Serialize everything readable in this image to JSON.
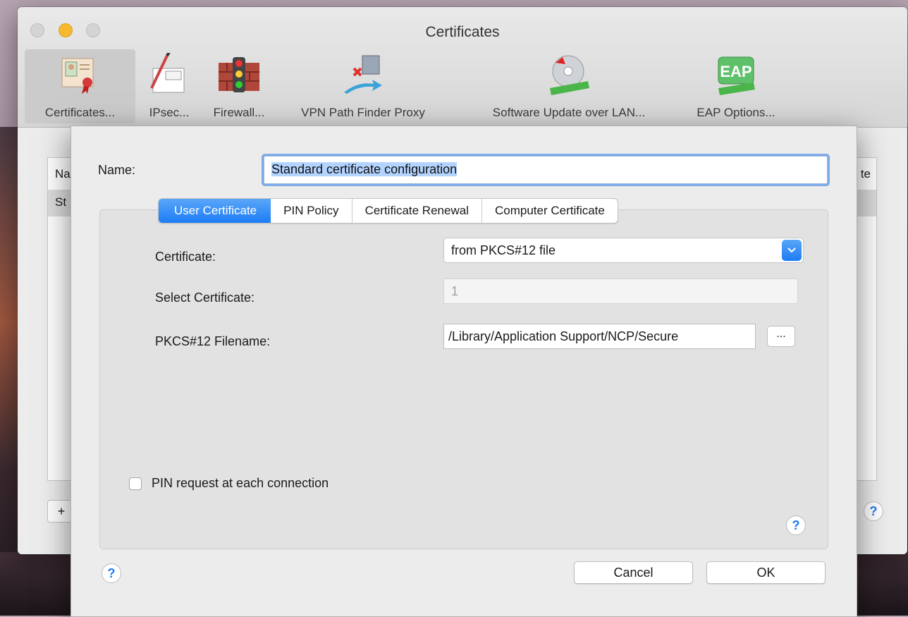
{
  "window": {
    "title": "Certificates"
  },
  "toolbar": {
    "items": [
      {
        "label": "Certificates...",
        "icon": "certificate-icon",
        "selected": true
      },
      {
        "label": "IPsec...",
        "icon": "policy-icon"
      },
      {
        "label": "Firewall...",
        "icon": "firewall-icon"
      },
      {
        "label": "VPN Path Finder Proxy",
        "icon": "path-finder-icon"
      },
      {
        "label": "Software Update over LAN...",
        "icon": "software-update-icon"
      },
      {
        "label": "EAP Options...",
        "icon": "eap-icon"
      }
    ],
    "eap_icon_text": "EAP"
  },
  "list": {
    "header_left": "Na",
    "header_right": "te",
    "row_left": "St"
  },
  "main": {
    "add_label": "+",
    "help_label": "?"
  },
  "dialog": {
    "name_label": "Name:",
    "name_value": "Standard certificate configuration",
    "tabs": [
      {
        "label": "User Certificate",
        "active": true
      },
      {
        "label": "PIN Policy"
      },
      {
        "label": "Certificate Renewal"
      },
      {
        "label": "Computer Certificate"
      }
    ],
    "certificate_label": "Certificate:",
    "certificate_value": "from PKCS#12 file",
    "select_certificate_label": "Select Certificate:",
    "select_certificate_value": "1",
    "pkcs_label": "PKCS#12 Filename:",
    "pkcs_value": "/Library/Application Support/NCP/Secure",
    "browse_label": "...",
    "pin_checkbox_label": "PIN request at each connection",
    "pin_checked": false,
    "help_label": "?",
    "cancel_label": "Cancel",
    "ok_label": "OK"
  },
  "colors": {
    "accent": "#1c7cf4",
    "window_bg": "#ececec"
  }
}
